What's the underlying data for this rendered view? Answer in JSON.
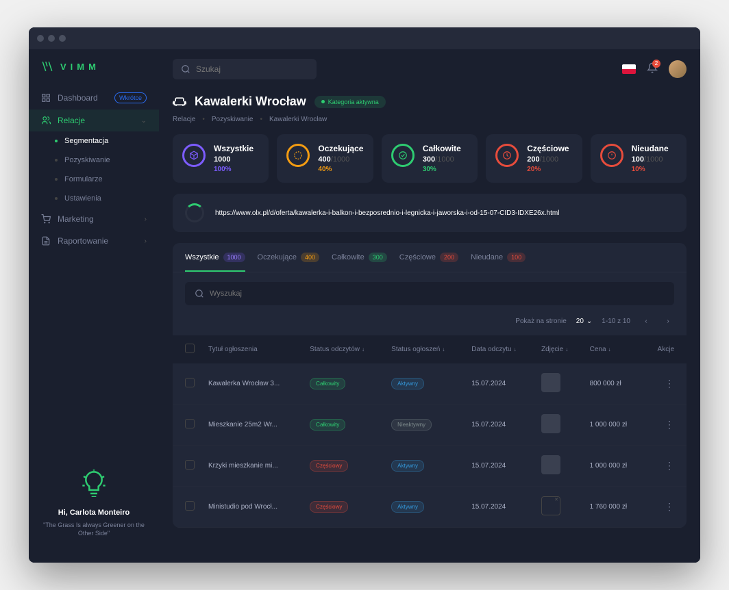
{
  "app": {
    "name": "VIMM"
  },
  "topbar": {
    "search_placeholder": "Szukaj",
    "notification_count": "2"
  },
  "sidebar": {
    "items": [
      {
        "label": "Dashboard",
        "badge": "Wkrótce"
      },
      {
        "label": "Relacje"
      },
      {
        "label": "Marketing"
      },
      {
        "label": "Raportowanie"
      }
    ],
    "sub_items": [
      {
        "label": "Segmentacja"
      },
      {
        "label": "Pozyskiwanie"
      },
      {
        "label": "Formularze"
      },
      {
        "label": "Ustawienia"
      }
    ],
    "footer": {
      "greeting": "Hi, Carlota Monteiro",
      "quote": "\"The Grass Is always Greener on the Other Side\""
    }
  },
  "header": {
    "title": "Kawalerki Wrocław",
    "category_badge": "Kategoria aktywna",
    "breadcrumb": [
      "Relacje",
      "Pozyskiwanie",
      "Kawalerki Wrocław"
    ]
  },
  "stats": [
    {
      "label": "Wszystkie",
      "value": "1000",
      "total": "",
      "pct": "100%",
      "color": "#7c5cff"
    },
    {
      "label": "Oczekujące",
      "value": "400",
      "total": "/1000",
      "pct": "40%",
      "color": "#f39c12"
    },
    {
      "label": "Całkowite",
      "value": "300",
      "total": "/1000",
      "pct": "30%",
      "color": "#2ecc71"
    },
    {
      "label": "Częściowe",
      "value": "200",
      "total": "/1000",
      "pct": "20%",
      "color": "#e74c3c"
    },
    {
      "label": "Nieudane",
      "value": "100",
      "total": "/1000",
      "pct": "10%",
      "color": "#e74c3c"
    }
  ],
  "url_bar": {
    "url": "https://www.olx.pl/d/oferta/kawalerka-i-balkon-i-bezposrednio-i-legnicka-i-jaworska-i-od-15-07-CID3-IDXE26x.html"
  },
  "tabs": [
    {
      "label": "Wszystkie",
      "count": "1000",
      "cls": ""
    },
    {
      "label": "Oczekujące",
      "count": "400",
      "cls": "orange"
    },
    {
      "label": "Całkowite",
      "count": "300",
      "cls": "green"
    },
    {
      "label": "Częściowe",
      "count": "200",
      "cls": "red"
    },
    {
      "label": "Nieudane",
      "count": "100",
      "cls": "red"
    }
  ],
  "table": {
    "search_placeholder": "Wyszukaj",
    "pagination": {
      "per_page_label": "Pokaż na stronie",
      "per_page_value": "20",
      "range": "1-10 z 10"
    },
    "columns": {
      "title": "Tytuł ogłoszenia",
      "status_read": "Status odczytów",
      "status_ad": "Status ogłoszeń",
      "date": "Data odczytu",
      "image": "Zdjęcie",
      "price": "Cena",
      "actions": "Akcje"
    },
    "rows": [
      {
        "title": "Kawalerka Wrocław 3...",
        "status_read": "Całkowity",
        "status_read_cls": "sp-green",
        "status_ad": "Aktywny",
        "status_ad_cls": "sp-blue",
        "date": "15.07.2024",
        "thumb": true,
        "price": "800 000 zł"
      },
      {
        "title": "Mieszkanie 25m2 Wr...",
        "status_read": "Całkowity",
        "status_read_cls": "sp-green",
        "status_ad": "Nieaktywny",
        "status_ad_cls": "sp-gray",
        "date": "15.07.2024",
        "thumb": true,
        "price": "1 000 000 zł"
      },
      {
        "title": "Krzyki mieszkanie mi...",
        "status_read": "Częściowy",
        "status_read_cls": "sp-red",
        "status_ad": "Aktywny",
        "status_ad_cls": "sp-blue",
        "date": "15.07.2024",
        "thumb": true,
        "price": "1 000 000 zł"
      },
      {
        "title": "Ministudio pod Wrocł...",
        "status_read": "Częściowy",
        "status_read_cls": "sp-red",
        "status_ad": "Aktywny",
        "status_ad_cls": "sp-blue",
        "date": "15.07.2024",
        "thumb": false,
        "price": "1 760 000 zł"
      }
    ]
  }
}
